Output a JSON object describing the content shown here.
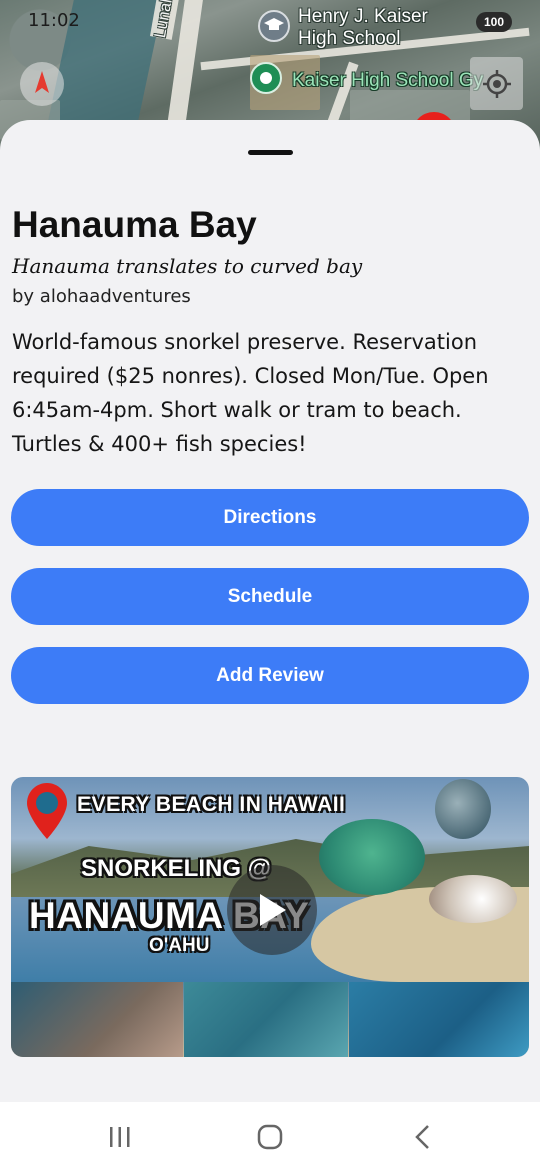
{
  "status_bar": {
    "time": "11:02",
    "battery": "100"
  },
  "map": {
    "labels": {
      "school": "Henry J. Kaiser\nHigh School",
      "gym": "Kaiser High School Gy",
      "road": "Lunalilo Home R"
    }
  },
  "place": {
    "title": "Hanauma Bay",
    "subtitle": "Hanauma translates to curved bay",
    "author": "by alohaadventures",
    "description": "World-famous snorkel preserve. Reservation required ($25 nonres). Closed Mon/Tue. Open 6:45am-4pm. Short walk or tram to beach. Turtles & 400+ fish species!"
  },
  "actions": {
    "directions": "Directions",
    "schedule": "Schedule",
    "add_review": "Add Review"
  },
  "video": {
    "banner": "EVERY BEACH IN HAWAII",
    "line1": "SNORKELING @",
    "line2": "HANAUMA BAY",
    "line3": "O'AHU"
  },
  "colors": {
    "button": "#3d7cf7",
    "sheet": "#f2f2f4",
    "navbar": "#ffffff"
  },
  "icons": {
    "compass": "compass-icon",
    "school": "graduation-cap-icon",
    "gym": "location-dot-icon",
    "locate": "my-location-icon",
    "play": "play-icon",
    "recents": "recents-icon",
    "home": "home-icon",
    "back": "back-icon"
  }
}
